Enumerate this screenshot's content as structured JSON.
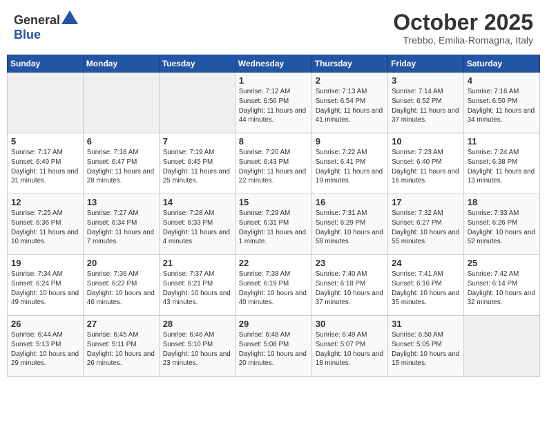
{
  "header": {
    "logo_general": "General",
    "logo_blue": "Blue",
    "month": "October 2025",
    "location": "Trebbo, Emilia-Romagna, Italy"
  },
  "days_of_week": [
    "Sunday",
    "Monday",
    "Tuesday",
    "Wednesday",
    "Thursday",
    "Friday",
    "Saturday"
  ],
  "weeks": [
    [
      {
        "day": "",
        "content": ""
      },
      {
        "day": "",
        "content": ""
      },
      {
        "day": "",
        "content": ""
      },
      {
        "day": "1",
        "content": "Sunrise: 7:12 AM\nSunset: 6:56 PM\nDaylight: 11 hours and 44 minutes."
      },
      {
        "day": "2",
        "content": "Sunrise: 7:13 AM\nSunset: 6:54 PM\nDaylight: 11 hours and 41 minutes."
      },
      {
        "day": "3",
        "content": "Sunrise: 7:14 AM\nSunset: 6:52 PM\nDaylight: 11 hours and 37 minutes."
      },
      {
        "day": "4",
        "content": "Sunrise: 7:16 AM\nSunset: 6:50 PM\nDaylight: 11 hours and 34 minutes."
      }
    ],
    [
      {
        "day": "5",
        "content": "Sunrise: 7:17 AM\nSunset: 6:49 PM\nDaylight: 11 hours and 31 minutes."
      },
      {
        "day": "6",
        "content": "Sunrise: 7:18 AM\nSunset: 6:47 PM\nDaylight: 11 hours and 28 minutes."
      },
      {
        "day": "7",
        "content": "Sunrise: 7:19 AM\nSunset: 6:45 PM\nDaylight: 11 hours and 25 minutes."
      },
      {
        "day": "8",
        "content": "Sunrise: 7:20 AM\nSunset: 6:43 PM\nDaylight: 11 hours and 22 minutes."
      },
      {
        "day": "9",
        "content": "Sunrise: 7:22 AM\nSunset: 6:41 PM\nDaylight: 11 hours and 19 minutes."
      },
      {
        "day": "10",
        "content": "Sunrise: 7:23 AM\nSunset: 6:40 PM\nDaylight: 11 hours and 16 minutes."
      },
      {
        "day": "11",
        "content": "Sunrise: 7:24 AM\nSunset: 6:38 PM\nDaylight: 11 hours and 13 minutes."
      }
    ],
    [
      {
        "day": "12",
        "content": "Sunrise: 7:25 AM\nSunset: 6:36 PM\nDaylight: 11 hours and 10 minutes."
      },
      {
        "day": "13",
        "content": "Sunrise: 7:27 AM\nSunset: 6:34 PM\nDaylight: 11 hours and 7 minutes."
      },
      {
        "day": "14",
        "content": "Sunrise: 7:28 AM\nSunset: 6:33 PM\nDaylight: 11 hours and 4 minutes."
      },
      {
        "day": "15",
        "content": "Sunrise: 7:29 AM\nSunset: 6:31 PM\nDaylight: 11 hours and 1 minute."
      },
      {
        "day": "16",
        "content": "Sunrise: 7:31 AM\nSunset: 6:29 PM\nDaylight: 10 hours and 58 minutes."
      },
      {
        "day": "17",
        "content": "Sunrise: 7:32 AM\nSunset: 6:27 PM\nDaylight: 10 hours and 55 minutes."
      },
      {
        "day": "18",
        "content": "Sunrise: 7:33 AM\nSunset: 6:26 PM\nDaylight: 10 hours and 52 minutes."
      }
    ],
    [
      {
        "day": "19",
        "content": "Sunrise: 7:34 AM\nSunset: 6:24 PM\nDaylight: 10 hours and 49 minutes."
      },
      {
        "day": "20",
        "content": "Sunrise: 7:36 AM\nSunset: 6:22 PM\nDaylight: 10 hours and 46 minutes."
      },
      {
        "day": "21",
        "content": "Sunrise: 7:37 AM\nSunset: 6:21 PM\nDaylight: 10 hours and 43 minutes."
      },
      {
        "day": "22",
        "content": "Sunrise: 7:38 AM\nSunset: 6:19 PM\nDaylight: 10 hours and 40 minutes."
      },
      {
        "day": "23",
        "content": "Sunrise: 7:40 AM\nSunset: 6:18 PM\nDaylight: 10 hours and 37 minutes."
      },
      {
        "day": "24",
        "content": "Sunrise: 7:41 AM\nSunset: 6:16 PM\nDaylight: 10 hours and 35 minutes."
      },
      {
        "day": "25",
        "content": "Sunrise: 7:42 AM\nSunset: 6:14 PM\nDaylight: 10 hours and 32 minutes."
      }
    ],
    [
      {
        "day": "26",
        "content": "Sunrise: 6:44 AM\nSunset: 5:13 PM\nDaylight: 10 hours and 29 minutes."
      },
      {
        "day": "27",
        "content": "Sunrise: 6:45 AM\nSunset: 5:11 PM\nDaylight: 10 hours and 26 minutes."
      },
      {
        "day": "28",
        "content": "Sunrise: 6:46 AM\nSunset: 5:10 PM\nDaylight: 10 hours and 23 minutes."
      },
      {
        "day": "29",
        "content": "Sunrise: 6:48 AM\nSunset: 5:08 PM\nDaylight: 10 hours and 20 minutes."
      },
      {
        "day": "30",
        "content": "Sunrise: 6:49 AM\nSunset: 5:07 PM\nDaylight: 10 hours and 18 minutes."
      },
      {
        "day": "31",
        "content": "Sunrise: 6:50 AM\nSunset: 5:05 PM\nDaylight: 10 hours and 15 minutes."
      },
      {
        "day": "",
        "content": ""
      }
    ]
  ]
}
